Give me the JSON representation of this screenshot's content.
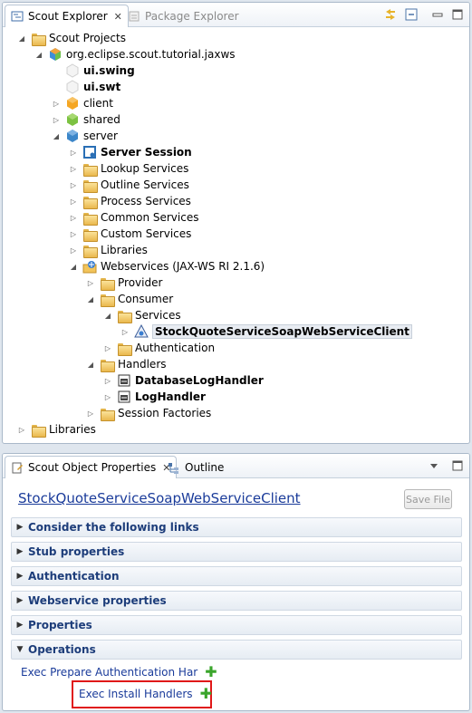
{
  "top_panel": {
    "tabs": [
      {
        "label": "Scout Explorer",
        "active": true
      },
      {
        "label": "Package Explorer",
        "active": false
      }
    ],
    "tree": [
      {
        "label": "Scout Projects",
        "indent": 0,
        "twisty": "open",
        "icon": "folder",
        "bold": false
      },
      {
        "label": "org.eclipse.scout.tutorial.jaxws",
        "indent": 1,
        "twisty": "open",
        "icon": "project",
        "bold": false
      },
      {
        "label": "ui.swing",
        "indent": 2,
        "twisty": "none",
        "icon": "hex-white",
        "bold": true
      },
      {
        "label": "ui.swt",
        "indent": 2,
        "twisty": "none",
        "icon": "hex-white",
        "bold": true
      },
      {
        "label": "client",
        "indent": 2,
        "twisty": "closed",
        "icon": "hex-orange",
        "bold": false
      },
      {
        "label": "shared",
        "indent": 2,
        "twisty": "closed",
        "icon": "hex-green",
        "bold": false
      },
      {
        "label": "server",
        "indent": 2,
        "twisty": "open",
        "icon": "hex-blue",
        "bold": false
      },
      {
        "label": "Server Session",
        "indent": 3,
        "twisty": "closed",
        "icon": "session",
        "bold": true
      },
      {
        "label": "Lookup Services",
        "indent": 3,
        "twisty": "closed",
        "icon": "folder",
        "bold": false
      },
      {
        "label": "Outline Services",
        "indent": 3,
        "twisty": "closed",
        "icon": "folder",
        "bold": false
      },
      {
        "label": "Process Services",
        "indent": 3,
        "twisty": "closed",
        "icon": "folder",
        "bold": false
      },
      {
        "label": "Common Services",
        "indent": 3,
        "twisty": "closed",
        "icon": "folder",
        "bold": false
      },
      {
        "label": "Custom Services",
        "indent": 3,
        "twisty": "closed",
        "icon": "folder",
        "bold": false
      },
      {
        "label": "Libraries",
        "indent": 3,
        "twisty": "closed",
        "icon": "folder",
        "bold": false
      },
      {
        "label": "Webservices (JAX-WS RI 2.1.6)",
        "indent": 3,
        "twisty": "open",
        "icon": "ws-folder",
        "bold": false
      },
      {
        "label": "Provider",
        "indent": 4,
        "twisty": "closed",
        "icon": "folder",
        "bold": false
      },
      {
        "label": "Consumer",
        "indent": 4,
        "twisty": "open",
        "icon": "folder",
        "bold": false
      },
      {
        "label": "Services",
        "indent": 5,
        "twisty": "open",
        "icon": "folder",
        "bold": false
      },
      {
        "label": "StockQuoteServiceSoapWebServiceClient",
        "indent": 6,
        "twisty": "closed",
        "icon": "ws-client",
        "bold": true,
        "selected": true
      },
      {
        "label": "Authentication",
        "indent": 5,
        "twisty": "closed",
        "icon": "folder",
        "bold": false
      },
      {
        "label": "Handlers",
        "indent": 4,
        "twisty": "open",
        "icon": "folder",
        "bold": false
      },
      {
        "label": "DatabaseLogHandler",
        "indent": 5,
        "twisty": "closed",
        "icon": "handler",
        "bold": true
      },
      {
        "label": "LogHandler",
        "indent": 5,
        "twisty": "closed",
        "icon": "handler",
        "bold": true
      },
      {
        "label": "Session Factories",
        "indent": 4,
        "twisty": "closed",
        "icon": "folder",
        "bold": false
      },
      {
        "label": "Libraries",
        "indent": 0,
        "twisty": "closed",
        "icon": "folder",
        "bold": false
      }
    ]
  },
  "bottom_panel": {
    "tabs": [
      {
        "label": "Scout Object Properties",
        "active": true
      },
      {
        "label": "Outline",
        "active": false
      }
    ],
    "title": "StockQuoteServiceSoapWebServiceClient",
    "save_label": "Save File",
    "sections": [
      {
        "label": "Consider the following links",
        "expanded": false
      },
      {
        "label": "Stub properties",
        "expanded": false
      },
      {
        "label": "Authentication",
        "expanded": false
      },
      {
        "label": "Webservice properties",
        "expanded": false
      },
      {
        "label": "Properties",
        "expanded": false
      },
      {
        "label": "Operations",
        "expanded": true
      }
    ],
    "operations": [
      {
        "label": "Exec Prepare Authentication Har"
      },
      {
        "label": "Exec Install Handlers"
      }
    ]
  },
  "colors": {
    "highlight": "#e01818",
    "link": "#1a3b9a",
    "section_text": "#1d3d7a"
  }
}
